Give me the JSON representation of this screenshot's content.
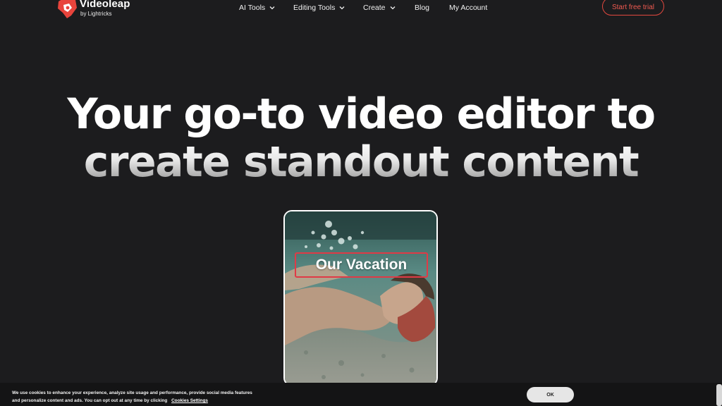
{
  "header": {
    "brand": "Videoleap",
    "brand_sub": "by Lightricks",
    "nav": {
      "ai_tools": "AI Tools",
      "editing_tools": "Editing Tools",
      "create": "Create",
      "blog": "Blog",
      "my_account": "My Account"
    },
    "cta": "Start free trial"
  },
  "hero": {
    "line1": "Your go-to video editor to",
    "line2": "create standout content"
  },
  "preview": {
    "caption": "Our Vacation"
  },
  "cookie": {
    "text": "We use cookies to enhance your experience, analyze site usage and performance, provide social media features and personalize content and ads. You can opt out at any time by clicking",
    "link": "Cookies Settings",
    "ok": "OK"
  },
  "colors": {
    "background": "#1c1c1e",
    "accent": "#e2483f",
    "caption_border": "#e03a46"
  }
}
